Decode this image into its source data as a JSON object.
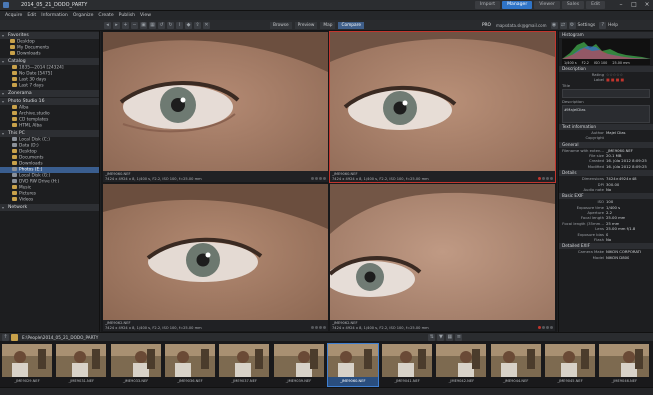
{
  "app": {
    "window_title": "2014_05_21_DODO_PARTY",
    "modes": [
      "Import",
      "Manager",
      "Viewer",
      "Sales",
      "Edit"
    ],
    "active_mode": "Manager"
  },
  "menu": [
    "Acquire",
    "Edit",
    "Information",
    "Organize",
    "Create",
    "Publish",
    "View"
  ],
  "toolbar": {
    "browse": "Browse",
    "preview": "Preview",
    "map": "Map",
    "compare": "Compare",
    "user": "PRO",
    "email": "mapsdata.sk@gmail.com",
    "settings": "Settings",
    "help": "Help"
  },
  "sidebar": {
    "favorites": {
      "title": "Favorites",
      "items": [
        "Desktop",
        "My Documents",
        "Downloads"
      ]
    },
    "catalog": {
      "title": "Catalog",
      "items": [
        "1835—2014 [24324]",
        "No Date [5475]",
        "Last 30 days",
        "Last 7 days"
      ]
    },
    "zoner": {
      "title": "Zonerama"
    },
    "studio": {
      "title": "Photo Studio 16",
      "items": [
        "Alba",
        "Archive.studio",
        "CD templates",
        "HTML Alba"
      ]
    },
    "pc": {
      "title": "This PC",
      "items": [
        "Local Disk (C:)",
        "Data (D:)",
        "Desktop",
        "Documents",
        "Downloads",
        "Photos (E:)",
        "Local Disk (G:)",
        "DVD RW Drive (H:)",
        "Music",
        "Pictures",
        "Videos"
      ],
      "selected": "Photos (E:)"
    },
    "network": {
      "title": "Network"
    }
  },
  "viewer": {
    "panes": [
      {
        "file": "_JME9060.NEF",
        "info": "7424 x 4924 x 8, 1/400 s, F2.2, ISO 100, f=25.00 mm"
      },
      {
        "file": "_JME9060.NEF",
        "info": "7424 x 4924 x 8, 1/400 s, F2.2, ISO 100, f=25.00 mm"
      },
      {
        "file": "_JME9062.NEF",
        "info": "7424 x 4924 x 8, 1/400 s, F2.2, ISO 100, f=25.00 mm"
      },
      {
        "file": "_JME9062.NEF",
        "info": "7424 x 4924 x 8, 1/400 s, F2.2, ISO 100, f=25.00 mm"
      }
    ]
  },
  "right": {
    "histogram_title": "Histogram",
    "histogram_readout": [
      "1/400 s",
      "F2.2",
      "ISO 100",
      "25.00 mm"
    ],
    "description_title": "Description",
    "rating_label": "Rating",
    "label_label": "Label",
    "title_label": "Title",
    "description_label": "Description",
    "description_value": "#MajelDias",
    "text_info_title": "Text information",
    "author_label": "Author",
    "author_value": "Majel Dias",
    "copyright_label": "Copyright",
    "general_title": "General",
    "general_rows": [
      [
        "Filename with exten...",
        "_JME9060.NEF"
      ],
      [
        "File size",
        "20.1 MB"
      ],
      [
        "Created",
        "16. júla 2012 8:09:25"
      ],
      [
        "Modified",
        "16. júla 2012 8:09:25"
      ]
    ],
    "details_title": "Details",
    "details_rows": [
      [
        "Dimensions",
        "7424×4924×48"
      ],
      [
        "DPI",
        "300.00"
      ],
      [
        "Audio note",
        "No"
      ]
    ],
    "exif_title": "Basic EXIF",
    "exif_rows": [
      [
        "ISO",
        "100"
      ],
      [
        "Exposure time",
        "1/400 s"
      ],
      [
        "Aperture",
        "2.2"
      ],
      [
        "Focal length",
        "25.00 mm"
      ],
      [
        "Focal length (35mm...",
        "25 mm"
      ],
      [
        "Lens",
        "25.00 mm f/1.8"
      ],
      [
        "Exposure bias",
        "0"
      ],
      [
        "Flash",
        "No"
      ]
    ],
    "detailed_exif_title": "Detailed EXIF",
    "detailed_rows": [
      [
        "Camera Make",
        "NIKON CORPORATI"
      ],
      [
        "Model",
        "NIKON D800"
      ]
    ]
  },
  "filmbar": {
    "path": "E:\\People\\2014_05_21_DODO_PARTY"
  },
  "film": {
    "thumbs": [
      "_JME9029.NEF",
      "_JME9031.NEF",
      "_JME9033.NEF",
      "_JME9036.NEF",
      "_JME9037.NEF",
      "_JME9039.NEF",
      "_JME9060.NEF",
      "_JME9041.NEF",
      "_JME9042.NEF",
      "_JME9044.NEF",
      "_JME9045.NEF",
      "_JME9046.NEF",
      "_JME9047.NEF"
    ],
    "selected_index": 6
  },
  "colors": {
    "accent": "#2f74c7",
    "selection_red": "#c2352d"
  }
}
